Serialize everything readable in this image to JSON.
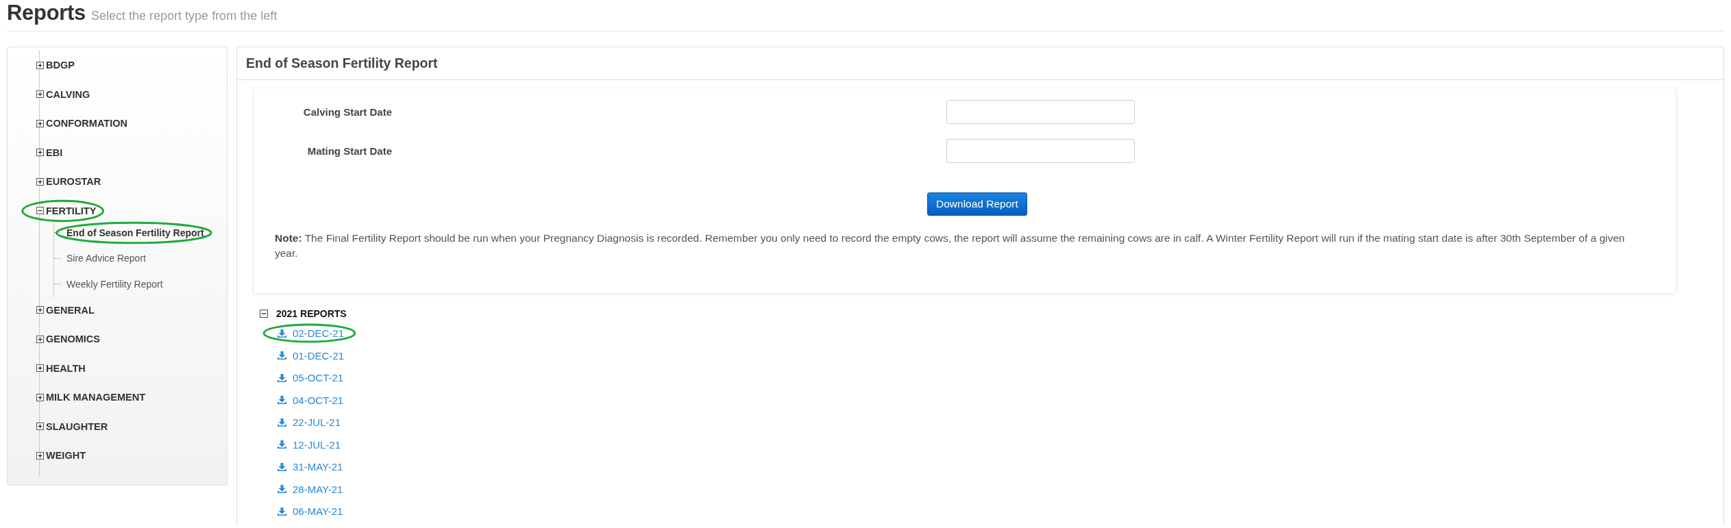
{
  "header": {
    "title": "Reports",
    "subtitle": "Select the report type from the left"
  },
  "sidebar": {
    "categories": [
      {
        "label": "BDGP",
        "expanded": false,
        "circled": false
      },
      {
        "label": "CALVING",
        "expanded": false,
        "circled": false
      },
      {
        "label": "CONFORMATION",
        "expanded": false,
        "circled": false
      },
      {
        "label": "EBI",
        "expanded": false,
        "circled": false
      },
      {
        "label": "EUROSTAR",
        "expanded": false,
        "circled": false
      },
      {
        "label": "FERTILITY",
        "expanded": true,
        "circled": true,
        "children": [
          {
            "label": "End of Season Fertility Report",
            "selected": true,
            "circled": true
          },
          {
            "label": "Sire Advice Report",
            "selected": false,
            "circled": false
          },
          {
            "label": "Weekly Fertility Report",
            "selected": false,
            "circled": false
          }
        ]
      },
      {
        "label": "GENERAL",
        "expanded": false,
        "circled": false
      },
      {
        "label": "GENOMICS",
        "expanded": false,
        "circled": false
      },
      {
        "label": "HEALTH",
        "expanded": false,
        "circled": false
      },
      {
        "label": "MILK MANAGEMENT",
        "expanded": false,
        "circled": false
      },
      {
        "label": "SLAUGHTER",
        "expanded": false,
        "circled": false
      },
      {
        "label": "WEIGHT",
        "expanded": false,
        "circled": false
      }
    ]
  },
  "panel": {
    "title": "End of Season Fertility Report",
    "fields": [
      {
        "label": "Calving Start Date"
      },
      {
        "label": "Mating Start Date"
      }
    ],
    "button": "Download Report",
    "note": "**Note:** The Final Fertility Report should be run when your Pregnancy Diagnosis is recorded. Remember you only need to record the empty cows, the report will assume the remaining cows are in calf. A Winter Fertility Report will run if the mating start date is after 30th September of a given year.",
    "report_groups": [
      {
        "label": "2021 REPORTS",
        "expanded": true,
        "reports": [
          {
            "date": "02-DEC-21",
            "circled": true
          },
          {
            "date": "01-DEC-21",
            "circled": false
          },
          {
            "date": "05-OCT-21",
            "circled": false
          },
          {
            "date": "04-OCT-21",
            "circled": false
          },
          {
            "date": "22-JUL-21",
            "circled": false
          },
          {
            "date": "12-JUL-21",
            "circled": false
          },
          {
            "date": "31-MAY-21",
            "circled": false
          },
          {
            "date": "28-MAY-21",
            "circled": false
          },
          {
            "date": "06-MAY-21",
            "circled": false
          }
        ]
      }
    ]
  }
}
